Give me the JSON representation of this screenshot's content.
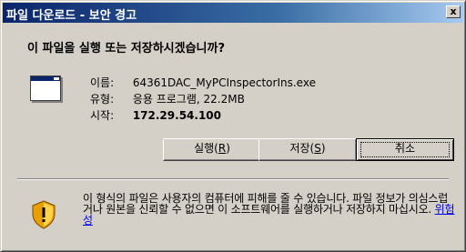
{
  "window": {
    "title": "파일 다운로드 - 보안 경고",
    "close_label": "x"
  },
  "prompt": {
    "question": "이 파일을 실행 또는 저장하시겠습니까?"
  },
  "file": {
    "icon": "application-window-icon",
    "name_label": "이름:",
    "name_value": "64361DAC_MyPCInspectorIns.exe",
    "type_label": "유형:",
    "type_value": "응용 프로그램, 22.2MB",
    "from_label": "시작:",
    "from_value": "172.29.54.100"
  },
  "buttons": {
    "run_label": "실행(",
    "run_key": "R",
    "run_end": ")",
    "save_label": "저장(",
    "save_key": "S",
    "save_end": ")",
    "cancel_label": "취소"
  },
  "warning": {
    "icon": "security-shield-icon",
    "text": "이 형식의 파일은 사용자의 컴퓨터에 피해를 줄 수 있습니다. 파일 정보가 의심스럽거나 원본을 신뢰할 수 없으면 이 소프트웨어를 실행하거나 저장하지 마십시오. ",
    "link_text": "위험성"
  },
  "colors": {
    "title_gradient_start": "#0a246a",
    "title_gradient_end": "#a6caf0",
    "dialog_face": "#d4d0c8",
    "link": "#0000ee"
  }
}
